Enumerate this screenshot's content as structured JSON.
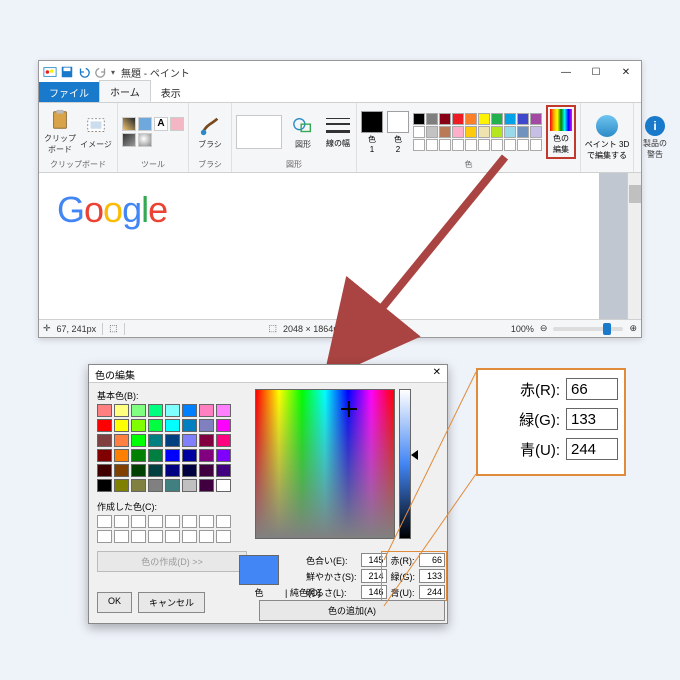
{
  "window": {
    "title": "無題 - ペイント",
    "tabs": {
      "file": "ファイル",
      "home": "ホーム",
      "view": "表示"
    },
    "controls": {
      "min": "—",
      "max": "☐",
      "close": "✕"
    }
  },
  "ribbon": {
    "clipboard": {
      "label": "クリップボード",
      "btn": "クリップ\nボード"
    },
    "image": {
      "label": "イメージ",
      "btn": "イメージ"
    },
    "tools": {
      "label": "ツール"
    },
    "brush": {
      "label": "ブラシ",
      "btn": "ブラシ"
    },
    "shapes": {
      "label": "図形",
      "btn": "図形"
    },
    "stroke": {
      "label": "線の幅",
      "btn": "線の幅"
    },
    "colors": {
      "label": "色",
      "c1": "色\n1",
      "c2": "色\n2"
    },
    "edit_colors": {
      "label": "色の\n編集"
    },
    "paint3d": {
      "label": "ペイント 3D\nで編集する"
    },
    "alerts": {
      "label": "製品の\n警告"
    }
  },
  "palette_top": [
    "#000",
    "#7f7f7f",
    "#880015",
    "#ed1c24",
    "#ff7f27",
    "#fff200",
    "#22b14c",
    "#00a2e8",
    "#3f48cc",
    "#a349a4"
  ],
  "palette_mid": [
    "#fff",
    "#c3c3c3",
    "#b97a57",
    "#ffaec9",
    "#ffc90e",
    "#efe4b0",
    "#b5e61d",
    "#99d9ea",
    "#7092be",
    "#c8bfe7"
  ],
  "palette_bot": [
    "#fff",
    "#fff",
    "#fff",
    "#fff",
    "#fff",
    "#fff",
    "#fff",
    "#fff",
    "#fff",
    "#fff"
  ],
  "canvas": {
    "google": [
      "G",
      "o",
      "o",
      "g",
      "l",
      "e"
    ]
  },
  "status": {
    "coords": "67, 241px",
    "size": "2048 × 1864px",
    "zoom": "100%"
  },
  "dialog": {
    "title": "色の編集",
    "basic_label": "基本色(B):",
    "custom_label": "作成した色(C):",
    "make_color": "色の作成(D) >>",
    "ok": "OK",
    "cancel": "キャンセル",
    "color_label": "色",
    "pure": "| 純色(O)",
    "hue_l": "色合い(E):",
    "hue_v": "145",
    "sat_l": "鮮やかさ(S):",
    "sat_v": "214",
    "lum_l": "明るさ(L):",
    "lum_v": "146",
    "r_l": "赤(R):",
    "r_v": "66",
    "g_l": "緑(G):",
    "g_v": "133",
    "b_l": "青(U):",
    "b_v": "244",
    "add": "色の追加(A)"
  },
  "basic_colors": [
    "#ff8080",
    "#ffff80",
    "#80ff80",
    "#00ff80",
    "#80ffff",
    "#0080ff",
    "#ff80c0",
    "#ff80ff",
    "#ff0000",
    "#ffff00",
    "#80ff00",
    "#00ff40",
    "#00ffff",
    "#0080c0",
    "#8080c0",
    "#ff00ff",
    "#804040",
    "#ff8040",
    "#00ff00",
    "#008080",
    "#004080",
    "#8080ff",
    "#800040",
    "#ff0080",
    "#800000",
    "#ff8000",
    "#008000",
    "#008040",
    "#0000ff",
    "#0000a0",
    "#800080",
    "#8000ff",
    "#400000",
    "#804000",
    "#004000",
    "#004040",
    "#000080",
    "#000040",
    "#400040",
    "#400080",
    "#000000",
    "#808000",
    "#808040",
    "#808080",
    "#408080",
    "#c0c0c0",
    "#400040",
    "#ffffff"
  ],
  "zoom": {
    "r_l": "赤(R):",
    "r_v": "66",
    "g_l": "緑(G):",
    "g_v": "133",
    "b_l": "青(U):",
    "b_v": "244"
  }
}
